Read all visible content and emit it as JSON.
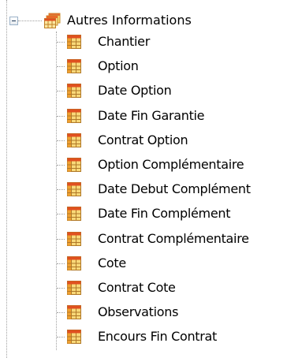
{
  "tree": {
    "root": {
      "label": "Autres Informations",
      "expanded": true,
      "icon": "multi-table-icon"
    },
    "children": [
      {
        "label": "Chantier",
        "icon": "table-icon"
      },
      {
        "label": "Option",
        "icon": "table-icon"
      },
      {
        "label": "Date Option",
        "icon": "table-icon"
      },
      {
        "label": "Date Fin Garantie",
        "icon": "table-icon"
      },
      {
        "label": "Contrat Option",
        "icon": "table-icon"
      },
      {
        "label": "Option Complémentaire",
        "icon": "table-icon"
      },
      {
        "label": "Date Debut Complément",
        "icon": "table-icon"
      },
      {
        "label": "Date Fin Complément",
        "icon": "table-icon"
      },
      {
        "label": "Contrat Complémentaire",
        "icon": "table-icon"
      },
      {
        "label": "Cote",
        "icon": "table-icon"
      },
      {
        "label": "Contrat Cote",
        "icon": "table-icon"
      },
      {
        "label": "Observations",
        "icon": "table-icon"
      },
      {
        "label": "Encours Fin Contrat",
        "icon": "table-icon"
      }
    ]
  },
  "colors": {
    "icon_orange": "#f0a030",
    "icon_red": "#e05020",
    "icon_yellow": "#f8d870",
    "guide_line": "#a0a0a0"
  }
}
